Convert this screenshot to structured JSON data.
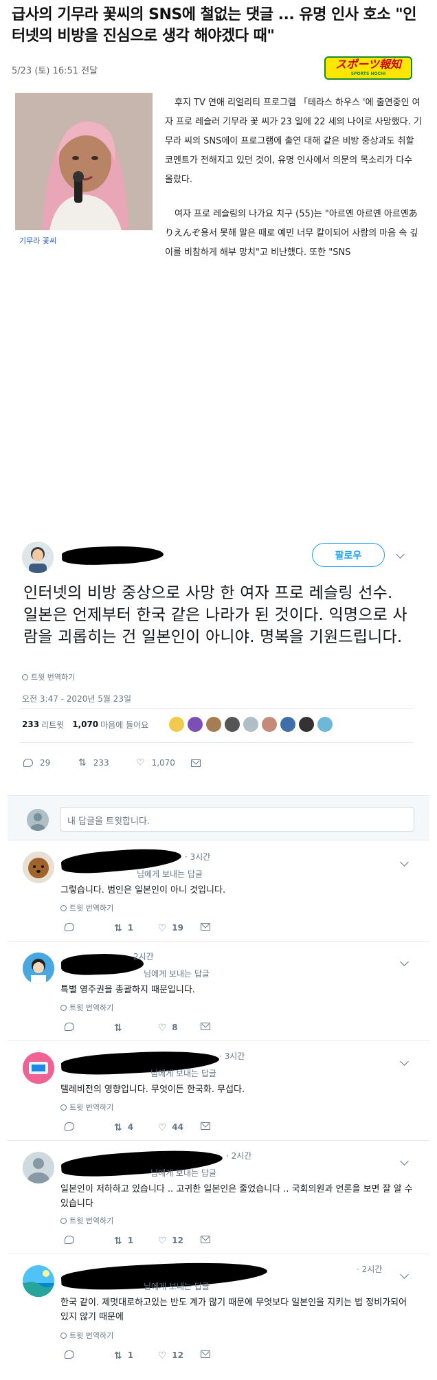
{
  "article": {
    "headline": "급사의 기무라 꽃씨의 SNS에 철없는 댓글 ... 유명 인사 호소 \"인터넷의 비방을 진심으로 생각 해야겠다 때\"",
    "date": "5/23 (토) 16:51 전달",
    "logo_main": "スポーツ報知",
    "logo_sub": "SPORTS HOCHI",
    "photo_caption": "기무라 꽃씨",
    "paragraph1": "후지 TV 연애 리얼리티 프로그램 「테라스 하우스 '에 출연중인 여자 프로 레슬러 기무라 꽃 씨가 23 일에 22 세의 나이로 사망했다. 기무라 씨의 SNS에이 프로그램에 출연 대해 같은 비방 중상과도 취할 코멘트가 전해지고 있던 것이, 유명 인사에서 의문의 목소리가 다수 올랐다.",
    "paragraph2": "여자 프로 레슬링의 나가요 치구 (55)는 \"아르옌 아르옌 아르옌ありえんぞ용서 못해 말은 때로 예민 너무 칼이되어 사람의 마음 속 깊이를 비참하게 해부 망치\"고 비난했다. 또한 \"SNS"
  },
  "tweet": {
    "follow_label": "팔로우",
    "text": "인터넷의 비방 중상으로 사망 한 여자 프로 레슬링 선수. 일본은 언제부터 한국 같은 나라가 된 것이다. 익명으로 사람을 괴롭히는 건 일본인이 아니야. 명복을 기원드립니다.",
    "translate_label": "트윗 번역하기",
    "timestamp": "오전 3:47 - 2020년 5월 23일",
    "retweets_count": "233",
    "retweets_label": "리트윗",
    "likes_count": "1,070",
    "likes_label": "마음에 들어요",
    "reply_count": "29",
    "retweet_action_count": "233",
    "like_action_count": "1,070"
  },
  "composer": {
    "placeholder": "내 답글을 트윗합니다."
  },
  "replies": [
    {
      "time": "· 3시간",
      "to": "님에게 보내는 답글",
      "text": "그렇습니다. 범인은 일본인이 아니 것입니다.",
      "translate": "트윗 번역하기",
      "retweets": "1",
      "likes": "19"
    },
    {
      "time": "2시간",
      "to": "님에게 보내는 답글",
      "text": "특별 영주권을 총괄하지 때문입니다.",
      "translate": "트윗 번역하기",
      "retweets": "",
      "likes": "8"
    },
    {
      "time": "· 3시간",
      "to": "님에게 보내는 답글",
      "text": "텔레비전의 영향입니다. 무엇이든 한국화. 무섭다.",
      "translate": "트윗 번역하기",
      "retweets": "4",
      "likes": "44"
    },
    {
      "time": "· 2시간",
      "to": "님에게 보내는 답글",
      "text": "일본인이 저하하고 있습니다 .. 고귀한 일본인은 줄었습니다 .. 국회의원과 언론을 보면 잘 알 수 있습니다",
      "translate": "트윗 번역하기",
      "retweets": "1",
      "likes": "12"
    },
    {
      "time": "· 2시간",
      "to": "님에게 보내는 답글",
      "text": "한국 같이. 제멋대로하고있는 반도 계가 많기 때문에 무엇보다 일본인을 지키는 법 정비가되어 있지 않기 때문에",
      "translate": "트윗 번역하기",
      "retweets": "1",
      "likes": "12"
    }
  ]
}
